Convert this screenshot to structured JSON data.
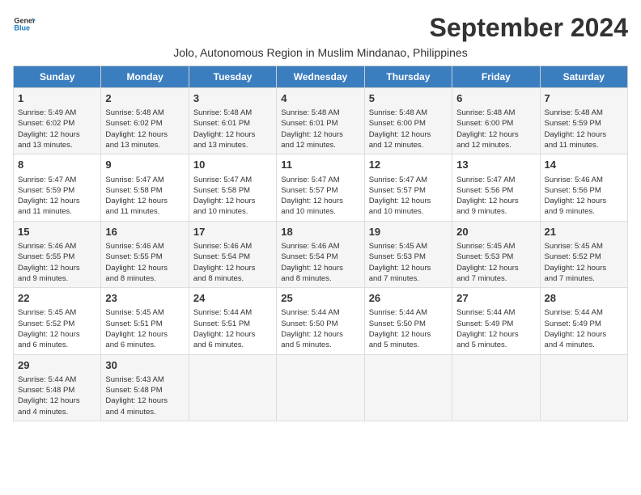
{
  "logo": {
    "line1": "General",
    "line2": "Blue"
  },
  "title": "September 2024",
  "subtitle": "Jolo, Autonomous Region in Muslim Mindanao, Philippines",
  "headers": [
    "Sunday",
    "Monday",
    "Tuesday",
    "Wednesday",
    "Thursday",
    "Friday",
    "Saturday"
  ],
  "weeks": [
    [
      {
        "day": "1",
        "info": "Sunrise: 5:49 AM\nSunset: 6:02 PM\nDaylight: 12 hours\nand 13 minutes."
      },
      {
        "day": "2",
        "info": "Sunrise: 5:48 AM\nSunset: 6:02 PM\nDaylight: 12 hours\nand 13 minutes."
      },
      {
        "day": "3",
        "info": "Sunrise: 5:48 AM\nSunset: 6:01 PM\nDaylight: 12 hours\nand 13 minutes."
      },
      {
        "day": "4",
        "info": "Sunrise: 5:48 AM\nSunset: 6:01 PM\nDaylight: 12 hours\nand 12 minutes."
      },
      {
        "day": "5",
        "info": "Sunrise: 5:48 AM\nSunset: 6:00 PM\nDaylight: 12 hours\nand 12 minutes."
      },
      {
        "day": "6",
        "info": "Sunrise: 5:48 AM\nSunset: 6:00 PM\nDaylight: 12 hours\nand 12 minutes."
      },
      {
        "day": "7",
        "info": "Sunrise: 5:48 AM\nSunset: 5:59 PM\nDaylight: 12 hours\nand 11 minutes."
      }
    ],
    [
      {
        "day": "8",
        "info": "Sunrise: 5:47 AM\nSunset: 5:59 PM\nDaylight: 12 hours\nand 11 minutes."
      },
      {
        "day": "9",
        "info": "Sunrise: 5:47 AM\nSunset: 5:58 PM\nDaylight: 12 hours\nand 11 minutes."
      },
      {
        "day": "10",
        "info": "Sunrise: 5:47 AM\nSunset: 5:58 PM\nDaylight: 12 hours\nand 10 minutes."
      },
      {
        "day": "11",
        "info": "Sunrise: 5:47 AM\nSunset: 5:57 PM\nDaylight: 12 hours\nand 10 minutes."
      },
      {
        "day": "12",
        "info": "Sunrise: 5:47 AM\nSunset: 5:57 PM\nDaylight: 12 hours\nand 10 minutes."
      },
      {
        "day": "13",
        "info": "Sunrise: 5:47 AM\nSunset: 5:56 PM\nDaylight: 12 hours\nand 9 minutes."
      },
      {
        "day": "14",
        "info": "Sunrise: 5:46 AM\nSunset: 5:56 PM\nDaylight: 12 hours\nand 9 minutes."
      }
    ],
    [
      {
        "day": "15",
        "info": "Sunrise: 5:46 AM\nSunset: 5:55 PM\nDaylight: 12 hours\nand 9 minutes."
      },
      {
        "day": "16",
        "info": "Sunrise: 5:46 AM\nSunset: 5:55 PM\nDaylight: 12 hours\nand 8 minutes."
      },
      {
        "day": "17",
        "info": "Sunrise: 5:46 AM\nSunset: 5:54 PM\nDaylight: 12 hours\nand 8 minutes."
      },
      {
        "day": "18",
        "info": "Sunrise: 5:46 AM\nSunset: 5:54 PM\nDaylight: 12 hours\nand 8 minutes."
      },
      {
        "day": "19",
        "info": "Sunrise: 5:45 AM\nSunset: 5:53 PM\nDaylight: 12 hours\nand 7 minutes."
      },
      {
        "day": "20",
        "info": "Sunrise: 5:45 AM\nSunset: 5:53 PM\nDaylight: 12 hours\nand 7 minutes."
      },
      {
        "day": "21",
        "info": "Sunrise: 5:45 AM\nSunset: 5:52 PM\nDaylight: 12 hours\nand 7 minutes."
      }
    ],
    [
      {
        "day": "22",
        "info": "Sunrise: 5:45 AM\nSunset: 5:52 PM\nDaylight: 12 hours\nand 6 minutes."
      },
      {
        "day": "23",
        "info": "Sunrise: 5:45 AM\nSunset: 5:51 PM\nDaylight: 12 hours\nand 6 minutes."
      },
      {
        "day": "24",
        "info": "Sunrise: 5:44 AM\nSunset: 5:51 PM\nDaylight: 12 hours\nand 6 minutes."
      },
      {
        "day": "25",
        "info": "Sunrise: 5:44 AM\nSunset: 5:50 PM\nDaylight: 12 hours\nand 5 minutes."
      },
      {
        "day": "26",
        "info": "Sunrise: 5:44 AM\nSunset: 5:50 PM\nDaylight: 12 hours\nand 5 minutes."
      },
      {
        "day": "27",
        "info": "Sunrise: 5:44 AM\nSunset: 5:49 PM\nDaylight: 12 hours\nand 5 minutes."
      },
      {
        "day": "28",
        "info": "Sunrise: 5:44 AM\nSunset: 5:49 PM\nDaylight: 12 hours\nand 4 minutes."
      }
    ],
    [
      {
        "day": "29",
        "info": "Sunrise: 5:44 AM\nSunset: 5:48 PM\nDaylight: 12 hours\nand 4 minutes."
      },
      {
        "day": "30",
        "info": "Sunrise: 5:43 AM\nSunset: 5:48 PM\nDaylight: 12 hours\nand 4 minutes."
      },
      {
        "day": "",
        "info": ""
      },
      {
        "day": "",
        "info": ""
      },
      {
        "day": "",
        "info": ""
      },
      {
        "day": "",
        "info": ""
      },
      {
        "day": "",
        "info": ""
      }
    ]
  ]
}
